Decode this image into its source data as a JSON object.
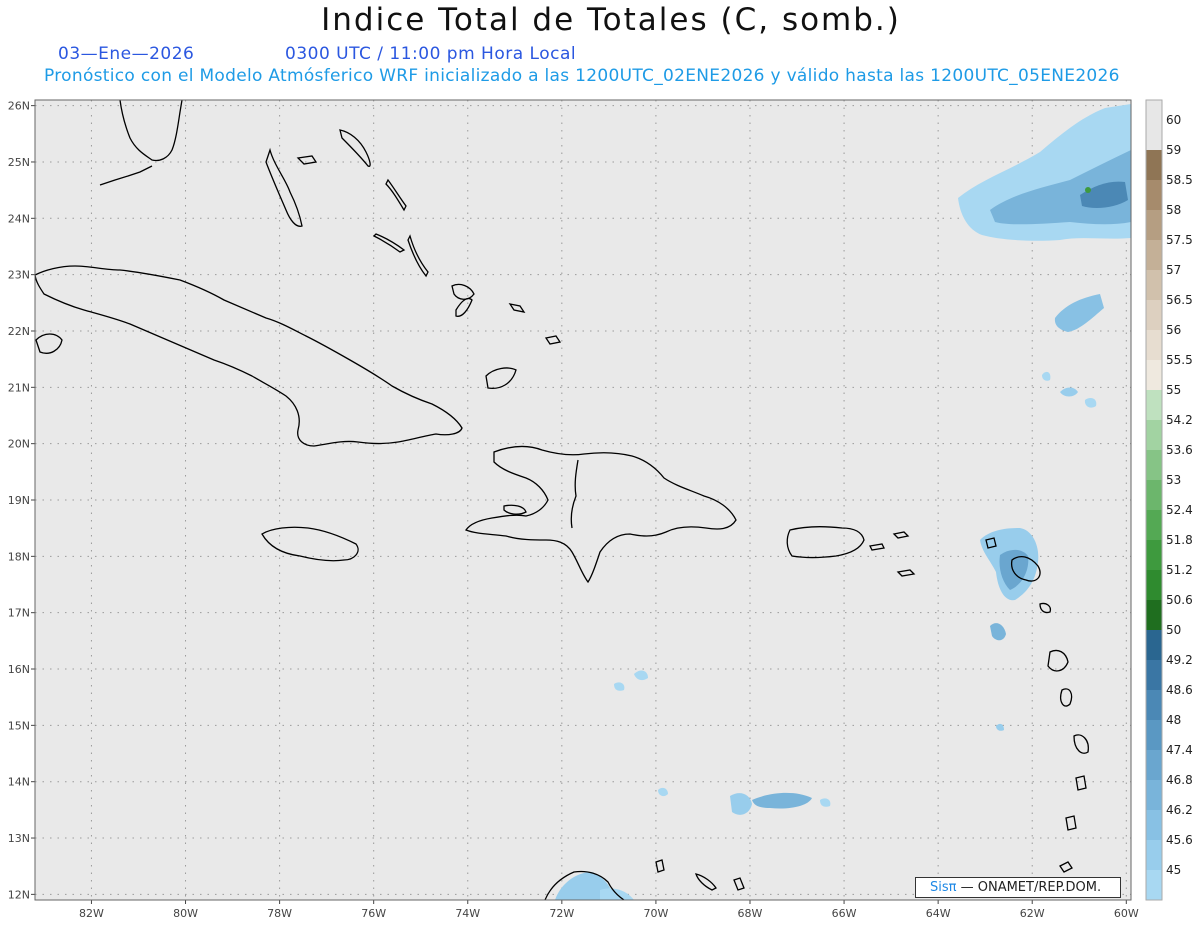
{
  "header": {
    "title": "Indice Total de Totales (C, somb.)",
    "date": "03—Ene—2026",
    "time": "0300 UTC / 11:00 pm Hora Local",
    "subtitle": "Pronóstico con el Modelo Atmósferico WRF inicializado a las 1200UTC_02ENE2026 y válido hasta las  1200UTC_05ENE2026"
  },
  "map": {
    "lat_labels": [
      "26N",
      "25N",
      "24N",
      "23N",
      "22N",
      "21N",
      "20N",
      "19N",
      "18N",
      "17N",
      "16N",
      "15N",
      "14N",
      "13N",
      "12N"
    ],
    "lon_labels": [
      "82W",
      "80W",
      "78W",
      "76W",
      "74W",
      "72W",
      "70W",
      "68W",
      "66W",
      "64W",
      "62W",
      "60W"
    ],
    "extent": {
      "lon_min": -83.2,
      "lon_max": -59.9,
      "lat_min": 11.9,
      "lat_max": 26.1
    },
    "background_color": "#e9e9e9",
    "coast_color": "#000000",
    "grid": "dotted"
  },
  "colorbar": {
    "levels": [
      "45",
      "45.6",
      "46.2",
      "46.8",
      "47.4",
      "48",
      "48.6",
      "49.2",
      "50",
      "50.6",
      "51.2",
      "51.8",
      "52.4",
      "53",
      "53.6",
      "54.2",
      "55",
      "55.5",
      "56",
      "56.5",
      "57",
      "57.5",
      "58",
      "58.5",
      "59",
      "60"
    ],
    "colors": [
      "#a8d8f2",
      "#98cdec",
      "#88c1e4",
      "#79b4da",
      "#6aa6cf",
      "#5a98c3",
      "#4b88b5",
      "#3a76a4",
      "#2a6690",
      "#1f6e1f",
      "#2f8b2f",
      "#3e9a3e",
      "#54a954",
      "#6cb66c",
      "#86c486",
      "#a2d3a2",
      "#bfe1bf",
      "#efe9df",
      "#e7ddd0",
      "#ddd0c0",
      "#d1c1ac",
      "#c4b097",
      "#b59e82",
      "#a68b6c",
      "#8f7555",
      "#e7e7e7"
    ]
  },
  "credit": {
    "logo": "Sisπ",
    "text": " —  ONAMET/REP.DOM."
  }
}
